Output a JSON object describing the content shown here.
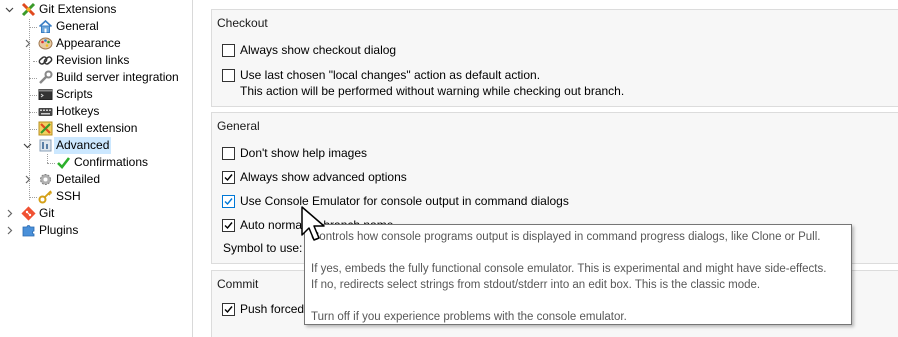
{
  "tree": {
    "items": [
      {
        "label": "Git Extensions",
        "icon": "git-extensions-icon"
      },
      {
        "label": "General",
        "icon": "house-icon"
      },
      {
        "label": "Appearance",
        "icon": "palette-icon"
      },
      {
        "label": "Revision links",
        "icon": "chain-link-icon"
      },
      {
        "label": "Build server integration",
        "icon": "wrench-icon"
      },
      {
        "label": "Scripts",
        "icon": "terminal-icon"
      },
      {
        "label": "Hotkeys",
        "icon": "keyboard-icon"
      },
      {
        "label": "Shell extension",
        "icon": "shell-extension-icon"
      },
      {
        "label": "Advanced",
        "icon": "advanced-settings-icon"
      },
      {
        "label": "Confirmations",
        "icon": "checkmark-icon"
      },
      {
        "label": "Detailed",
        "icon": "gear-icon"
      },
      {
        "label": "SSH",
        "icon": "key-icon"
      },
      {
        "label": "Git",
        "icon": "git-logo-icon"
      },
      {
        "label": "Plugins",
        "icon": "puzzle-icon"
      }
    ],
    "selected": "Advanced",
    "colors": {
      "selection": "#cce8ff",
      "confirm_check": "#2cb02c",
      "git_logo": "#f05133"
    }
  },
  "checkout": {
    "title": "Checkout",
    "always_show_checkout_dialog": {
      "label": "Always show checkout dialog",
      "checked": false
    },
    "use_last_chosen": {
      "label": "Use last chosen \"local changes\" action as default action.",
      "checked": false
    },
    "use_last_chosen_note": "This action will be performed without warning while checking out branch."
  },
  "general": {
    "title": "General",
    "dont_show_help_images": {
      "label": "Don't show help images",
      "checked": false
    },
    "always_show_advanced": {
      "label": "Always show advanced options",
      "checked": true
    },
    "use_console_emulator": {
      "label": "Use Console Emulator for console output in command dialogs",
      "checked": true
    },
    "auto_normalize_branch_name": {
      "label": "Auto normalize branch name",
      "checked": true
    },
    "symbol_label": "Symbol to use:"
  },
  "commit": {
    "title": "Commit",
    "push_forced": {
      "label": "Push forced",
      "checked": true
    }
  },
  "tooltip": {
    "line1": "Controls how console programs output is displayed in command progress dialogs, like Clone or Pull.",
    "line2": "",
    "line3": "If yes, embeds the fully functional console emulator. This is experimental and might have side-effects.",
    "line4": "If no, redirects select strings from stdout/stderr into an edit box. This is the classic mode.",
    "line5": "",
    "line6": "Turn off if you experience problems with the console emulator."
  }
}
